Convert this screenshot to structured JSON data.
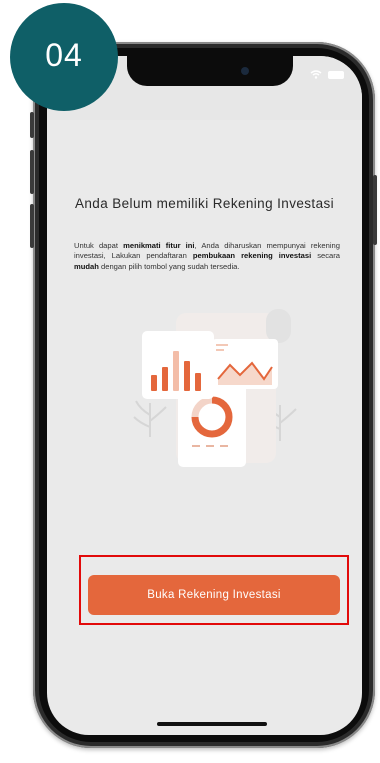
{
  "step": {
    "number": "04"
  },
  "status_bar": {
    "icons": [
      "wifi-icon",
      "battery-icon"
    ]
  },
  "content": {
    "title": "Anda Belum memiliki Rekening Investasi",
    "description": {
      "t1": "Untuk dapat ",
      "b1": "menikmati fitur ini",
      "t2": ", Anda diharuskan mempunyai rekening investasi, Lakukan pendaftaran ",
      "b2": "pembukaan rekening investasi",
      "t3": " secara ",
      "b3": "mudah",
      "t4": " dengan pilih tombol yang sudah tersedia."
    }
  },
  "cta": {
    "label": "Buka Rekening Investasi"
  },
  "colors": {
    "step_badge": "#0f5f67",
    "accent": "#e4673c",
    "highlight_border": "#e20a0a"
  }
}
